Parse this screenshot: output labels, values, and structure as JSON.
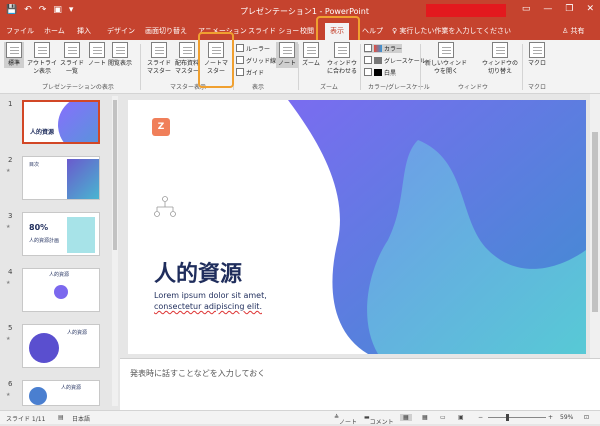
{
  "titlebar": {
    "title": "プレゼンテーション1 - PowerPoint",
    "minimize": "—",
    "restore": "❐",
    "close": "✕",
    "ribbon_opts": "▭"
  },
  "qat": {
    "save": "💾",
    "undo": "↶",
    "redo": "↷",
    "present": "▣",
    "more": "▾"
  },
  "tabs": [
    "ファイル",
    "ホーム",
    "挿入",
    "デザイン",
    "画面切り替え",
    "アニメーション",
    "スライド ショー",
    "校閲",
    "表示",
    "ヘルプ"
  ],
  "active_tab": "表示",
  "tell_me": "実行したい作業を入力してください",
  "share": "共有",
  "ribbon": {
    "pres_views": {
      "normal": "標準",
      "outline": "アウトライン表示",
      "sorter": "スライド一覧",
      "notes": "ノート",
      "reading": "閲覧表示",
      "label": "プレゼンテーションの表示"
    },
    "masters": {
      "slide": "スライドマスター",
      "handout": "配布資料マスター",
      "notes": "ノートマスター",
      "label": "マスター表示"
    },
    "show": {
      "ruler": "ルーラー",
      "grid": "グリッド線",
      "guides": "ガイド",
      "notes": "ノート",
      "label": "表示"
    },
    "zoom": {
      "zoom": "ズーム",
      "fit": "ウィンドウに合わせる",
      "label": "ズーム"
    },
    "color": {
      "color": "カラー",
      "gray": "グレースケール",
      "bw": "白黒",
      "label": "カラー/グレースケール"
    },
    "window": {
      "new": "新しいウィンドウを開く",
      "switch": "ウィンドウの切り替え",
      "label": "ウィンドウ"
    },
    "macro": {
      "macros": "マクロ",
      "label": "マクロ"
    }
  },
  "thumbs": [
    {
      "num": "1",
      "title": "人的資源"
    },
    {
      "num": "2",
      "title": "目次"
    },
    {
      "num": "3",
      "title": "80%",
      "sub": "人的資源計画"
    },
    {
      "num": "4",
      "title": "人的資源"
    },
    {
      "num": "5",
      "title": "人的資源"
    },
    {
      "num": "6",
      "title": "人的資源"
    }
  ],
  "slide": {
    "title": "人的資源",
    "subtitle_line1": "Lorem ipsum dolor sit amet,",
    "subtitle_line2": "consectetur adipiscing elit.",
    "logo": "Z"
  },
  "notes_placeholder": "発表時に話すことなどを入力しておく",
  "status": {
    "slide": "スライド 1/11",
    "lang": "日本語",
    "notes": "ノート",
    "comments": "コメント",
    "zoom": "59%"
  },
  "colors": {
    "accent": "#c5432e",
    "callout": "#f0a030",
    "title": "#1f2d5c"
  }
}
